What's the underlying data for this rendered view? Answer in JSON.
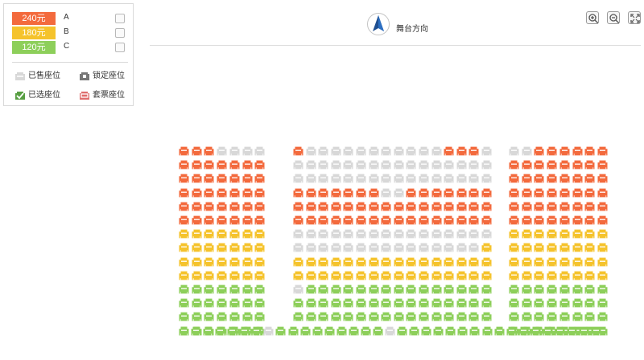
{
  "legend": {
    "prices": [
      {
        "price": "240元",
        "area": "A",
        "color": "#f36a3d"
      },
      {
        "price": "180元",
        "area": "B",
        "color": "#f5c32c"
      },
      {
        "price": "120元",
        "area": "C",
        "color": "#8dcf5a"
      }
    ],
    "statuses": [
      {
        "label": "已售座位",
        "icon": "sold-seat-icon",
        "color": "#d8d8d8"
      },
      {
        "label": "锁定座位",
        "icon": "locked-seat-icon",
        "color": "#777777"
      },
      {
        "label": "已选座位",
        "icon": "selected-seat-icon",
        "color": "#579e42"
      },
      {
        "label": "套票座位",
        "icon": "package-seat-icon",
        "color": "#df6e6e"
      }
    ]
  },
  "stage": {
    "label": "舞台方向",
    "icon": "north-arrow-icon"
  },
  "toolbar": {
    "zoom_in_icon": "zoom-in-icon",
    "zoom_out_icon": "zoom-out-icon",
    "fullscreen_icon": "fullscreen-icon"
  },
  "seat_map": {
    "colors": {
      "A": "#f36a3d",
      "B": "#f5c32c",
      "C": "#8dcf5a",
      "sold": "#d8d8d8"
    },
    "sections": [
      {
        "name": "left",
        "rows": [
          "AAASSSS",
          "AAAAAAA",
          "AAAAAAA",
          "AAAAAAA",
          "AAAAAAA",
          "AAAAAAA",
          "BBBBBBB",
          "BBBBBBB",
          "BBBBBBB",
          "BBBBBBB",
          "CCCCCCC",
          "CCCCCCC",
          "CCCCCCC",
          "CCCCCCC"
        ]
      },
      {
        "name": "center",
        "rows": [
          "ASSSSSSSSSSSAAAS",
          "SSSSSSSSSSSSSSSS",
          "SSSSSSSSSSSSSSSS",
          "AAAAAAASSAAAAAAA",
          "AAAAAAAAAAAAAAAA",
          "AAAAAAAAAAAAAAAA",
          "SSSSSSSSSSSSSSSS",
          "SSSSSSSSSSSSSSSB",
          "BBBBBBBBBBBBBBBB",
          "BBBBBBBBBBBBBBBB",
          "SCCCCCCCCCCCCCCC",
          "CCCCCCCCCCCCCCCC",
          "CCCCCCCCCCCCCCCC"
        ]
      },
      {
        "name": "right",
        "rows": [
          "SSAAAAAA",
          "AAAAAAAA",
          "AAAAAAAA",
          "AAAAAAAA",
          "AAAAAAAA",
          "AAAAAAAA",
          "BBBBBBBB",
          "BBBBBBBB",
          "BBBBBBBB",
          "BBBBBBBB",
          "CCCCCCCC",
          "CCCCCCCC",
          "CCCCCCCC",
          "CCCCCCCC"
        ]
      }
    ],
    "bottom_row": "CCCCCCCSCCCCCCCCCSCCCCCCCCCCCCCCCCC"
  }
}
